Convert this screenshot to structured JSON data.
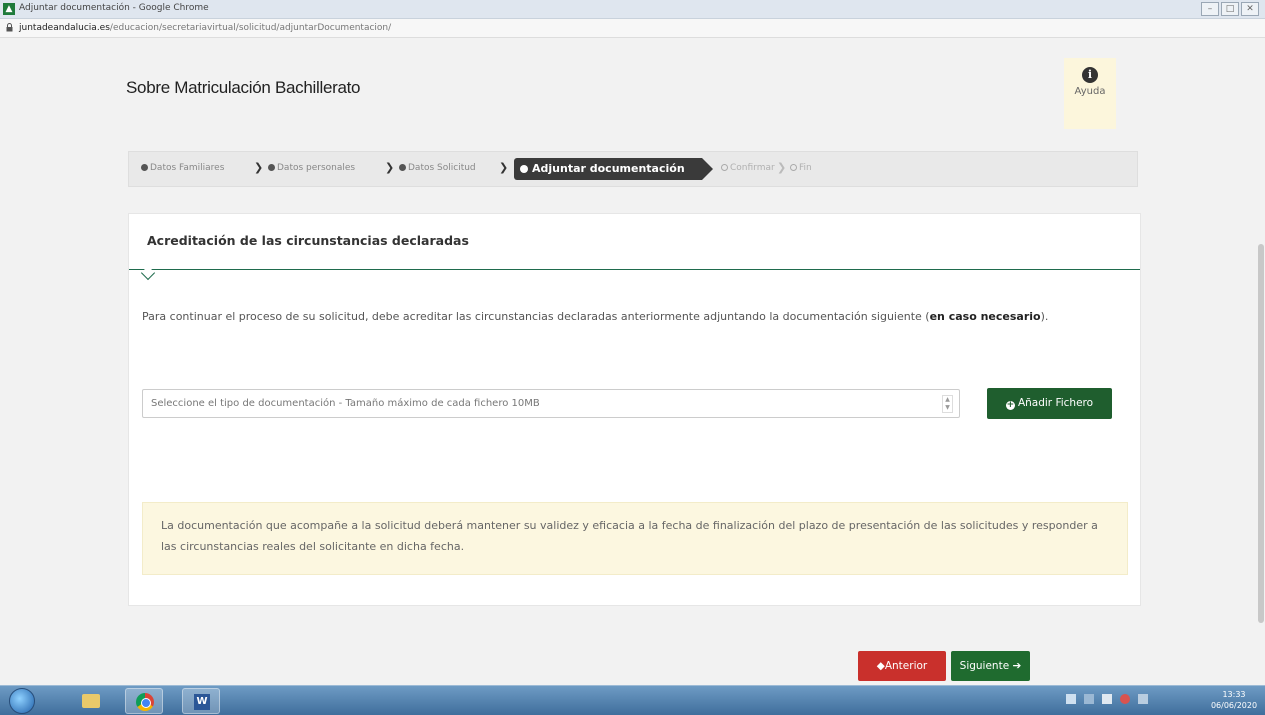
{
  "window": {
    "title": "Adjuntar documentación - Google Chrome",
    "controls": [
      "–",
      "□",
      "✕"
    ]
  },
  "address": {
    "host": "juntadeandalucia.es",
    "path": "/educacion/secretariavirtual/solicitud/adjuntarDocumentacion/"
  },
  "page": {
    "title": "Sobre Matriculación Bachillerato",
    "help_label": "Ayuda",
    "help_icon": "i"
  },
  "steps": {
    "s1": "Datos Familiares",
    "s2": "Datos personales",
    "s3": "Datos Solicitud",
    "active": "Adjuntar documentación",
    "s5": "Confirmar",
    "s6": "Fin"
  },
  "panel": {
    "title": "Acreditación de las circunstancias declaradas",
    "intro_text": "Para continuar el proceso de su solicitud, debe acreditar las circunstancias declaradas anteriormente adjuntando la documentación siguiente (",
    "intro_bold": "en caso necesario",
    "intro_end": ").",
    "select_placeholder": "Seleccione el tipo de documentación - Tamaño máximo de cada fichero 10MB",
    "add_button": "Añadir Fichero",
    "notice": "La documentación que acompañe a la solicitud deberá mantener su validez y eficacia a la fecha de finalización del plazo de presentación de las solicitudes y responder a las circunstancias reales del solicitante en dicha fecha."
  },
  "nav": {
    "prev": "Anterior",
    "next": "Siguiente"
  },
  "taskbar": {
    "time": "13:33",
    "date": "06/06/2020"
  },
  "colors": {
    "brand_green": "#1f5e2e",
    "danger_red": "#c9302c",
    "notice_bg": "#fcf7e0"
  }
}
